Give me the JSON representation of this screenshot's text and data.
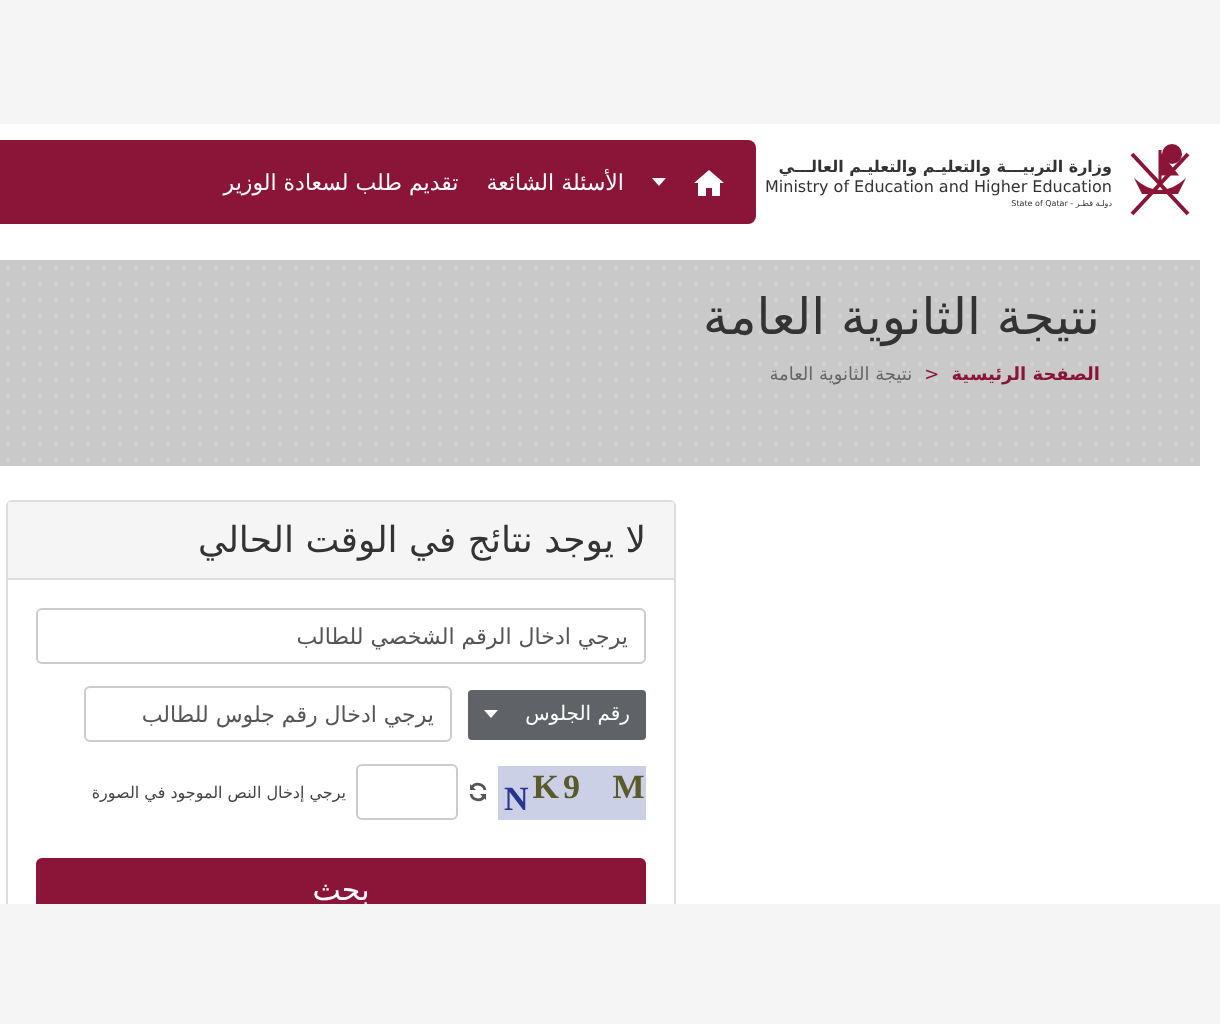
{
  "logo": {
    "arabic": "وزارة التربيـــة والتعليـم والتعليـم العالـــي",
    "english": "Ministry of Education and Higher Education",
    "state": "State of Qatar - دولـة قطـر"
  },
  "nav": {
    "links": [
      "الأسئلة الشائعة",
      "تقديم طلب لسعادة الوزير"
    ]
  },
  "banner": {
    "title": "نتيجة الثانوية العامة",
    "breadcrumb": [
      {
        "label": "الصفحة الرئيسية",
        "selected": false
      },
      {
        "label": "نتيجة الثانوية العامة",
        "selected": true
      }
    ],
    "separator": "<"
  },
  "panel": {
    "title": "لا يوجد نتائج في الوقت الحالي",
    "personal_id": {
      "placeholder": "يرجي ادخال الرقم الشخصي للطالب"
    },
    "id_type": {
      "label": "رقم الجلوس"
    },
    "seat_number": {
      "placeholder": "يرجي ادخال رقم جلوس للطالب"
    },
    "captcha": {
      "text": "$_{N}$K9 M",
      "hint": "يرجي إدخال النص الموجود في الصورة"
    },
    "search_button": "بحث"
  }
}
